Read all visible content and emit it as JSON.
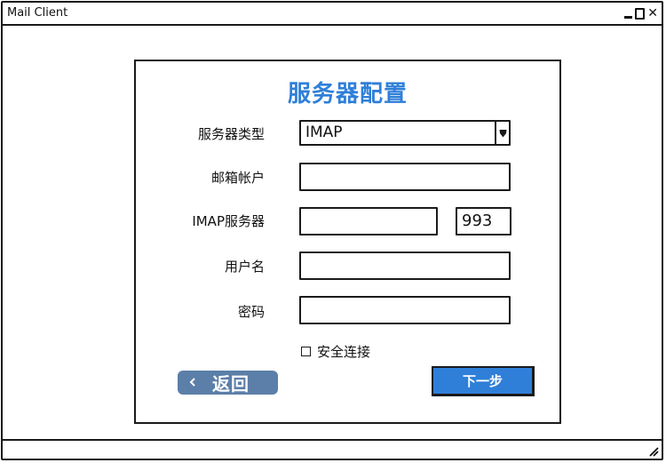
{
  "window": {
    "title": "Mail Client",
    "controls": {
      "minimize": "minimize-icon",
      "maximize": "maximize-icon",
      "close": "✕"
    }
  },
  "form": {
    "title": "服务器配置",
    "fields": {
      "server_type": {
        "label": "服务器类型",
        "value": "IMAP"
      },
      "account": {
        "label": "邮箱帐户",
        "value": ""
      },
      "imap_server": {
        "label": "IMAP服务器",
        "value": "",
        "port": "993"
      },
      "username": {
        "label": "用户名",
        "value": ""
      },
      "password": {
        "label": "密码",
        "value": ""
      }
    },
    "secure_connection": {
      "label": "安全连接",
      "checked": false
    },
    "buttons": {
      "back": "返回",
      "next": "下一步"
    }
  },
  "colors": {
    "accent": "#2f7fd8",
    "back_button": "#5b7fa8",
    "border": "#1a1a1a"
  }
}
